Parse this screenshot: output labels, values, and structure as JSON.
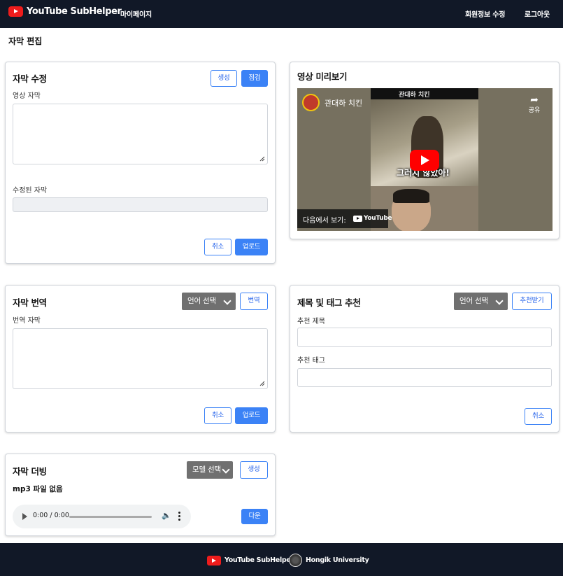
{
  "navbar": {
    "brand": "YouTube SubHelper",
    "mypage": "마이페이지",
    "edit_profile": "회원정보 수정",
    "logout": "로그아웃"
  },
  "page_title": "자막 편집",
  "edit_card": {
    "title": "자막 수정",
    "generate_btn": "생성",
    "check_btn": "점검",
    "original_label": "영상 자막",
    "revised_label": "수정된 자막",
    "cancel_btn": "취소",
    "upload_btn": "업로드"
  },
  "preview_card": {
    "title": "영상 미리보기",
    "channel_name": "관대하 치킨",
    "share_label": "공유",
    "watch_on": "다음에서 보기:",
    "youtube_word": "YouTube",
    "caption": "그러지 않았아!",
    "top_text": "관대하 치킨"
  },
  "translate_card": {
    "title": "자막 번역",
    "language_select": "언어 선택",
    "translate_btn": "번역",
    "translated_label": "번역 자막",
    "cancel_btn": "취소",
    "upload_btn": "업로드"
  },
  "recommend_card": {
    "title": "제목 및 태그 추천",
    "language_select": "언어 선택",
    "recommend_btn": "추천받기",
    "title_label": "추천 제목",
    "tag_label": "추천 태그",
    "cancel_btn": "취소"
  },
  "dubbing_card": {
    "title": "자막 더빙",
    "model_select": "모델 선택",
    "generate_btn": "생성",
    "no_file": "mp3 파일 없음",
    "audio_time": "0:00 / 0:00",
    "download_btn": "다운"
  },
  "footer": {
    "brand": "YouTube SubHelper",
    "university": "Hongik University"
  },
  "colors": {
    "navbar_bg": "#111827",
    "primary": "#3b82f6",
    "select_bg": "#707070"
  }
}
